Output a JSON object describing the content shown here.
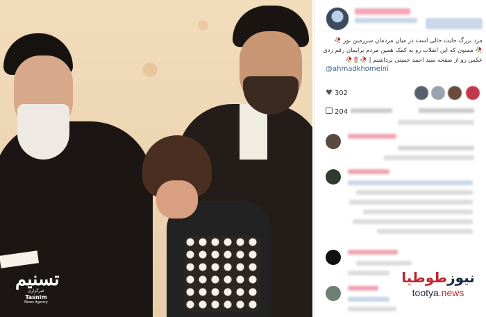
{
  "post": {
    "caption_line1": "مرد بزرگ جایت خالی است در میان مردمان سرزمین نور 🥀",
    "caption_line2": "🥀 ممنون که این انقلاب رو به کمک همین مردم برایمان رقم زدی",
    "caption_line3": "عکس رو از صفحه سید احمد خمینی برداشتم | 🥀🌷🥀",
    "mention": "@ahmadkhomeini",
    "likes_label": "302",
    "comments_label": "204"
  },
  "photo_logo": {
    "title": "تسنیم",
    "subtitle": "خبرگزاری",
    "english": "Tasnim",
    "agency": "News Agency"
  },
  "watermark": {
    "brand_red": "طوطیا",
    "brand_dark": "نیوز",
    "url_dark": "tootya",
    "url_red": ".news"
  },
  "colors": {
    "link": "#3c5b86",
    "brand_red": "#c0262f",
    "brand_dark": "#1b2940"
  },
  "icons": [
    "heart-icon",
    "comment-icon"
  ]
}
